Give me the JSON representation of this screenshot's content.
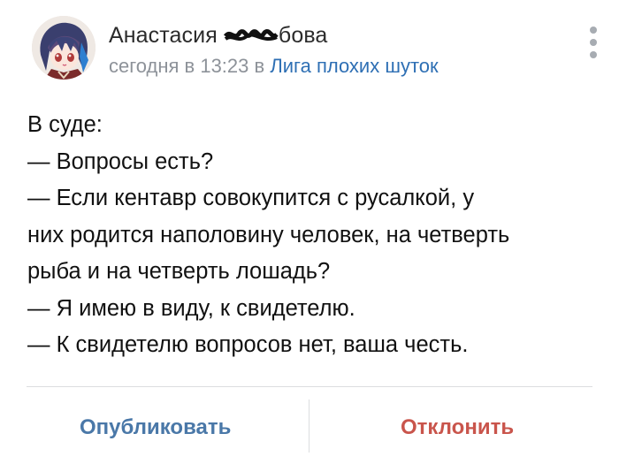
{
  "post": {
    "author_prefix": "Анастасия ",
    "author_suffix": "бова",
    "time": "сегодня в 13:23",
    "in_word": " в ",
    "group": "Лига плохих шуток",
    "lines": [
      "В суде:",
      "— Вопросы есть?",
      "— Если кентавр совокупится с русалкой, у",
      "них родится наполовину человек, на четверть",
      "рыба и на четверть лошадь?",
      "— Я имею в виду, к свидетелю.",
      "— К свидетелю вопросов нет, ваша честь."
    ]
  },
  "actions": {
    "publish": "Опубликовать",
    "reject": "Отклонить"
  },
  "colors": {
    "link": "#2e6fb4",
    "publish": "#4a78a8",
    "reject": "#c9554c",
    "meta": "#8d9299"
  },
  "icons": [
    "avatar",
    "more-vertical-icon"
  ]
}
